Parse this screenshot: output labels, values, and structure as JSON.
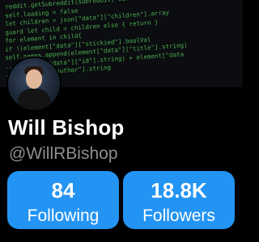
{
  "banner": {
    "code_lines": [
      "reddit.getSubreddit(subreddit, sort: sort, after: after, completionHandl",
      "  self.loading = false",
      "  let children = json[\"data\"][\"children\"].array",
      "  guard let child = children else { return }",
      "  for element in child{",
      "",
      "    if !(element[\"data\"][\"stickied\"].boolVal",
      "      self.names.append(element[\"data\"][\"title\"].string)",
      "      ... element[\"data\"][\"id\"].string) + element[\"data",
      "      ... [\"data\"][\"author\"].string"
    ]
  },
  "profile": {
    "name": "Will Bishop",
    "handle": "@WillRBishop"
  },
  "stats": {
    "following_count": "84",
    "following_label": "Following",
    "followers_count": "18.8K",
    "followers_label": "Followers"
  },
  "colors": {
    "accent": "#2394f4",
    "background": "#000000",
    "handle_gray": "#8d8d92"
  }
}
